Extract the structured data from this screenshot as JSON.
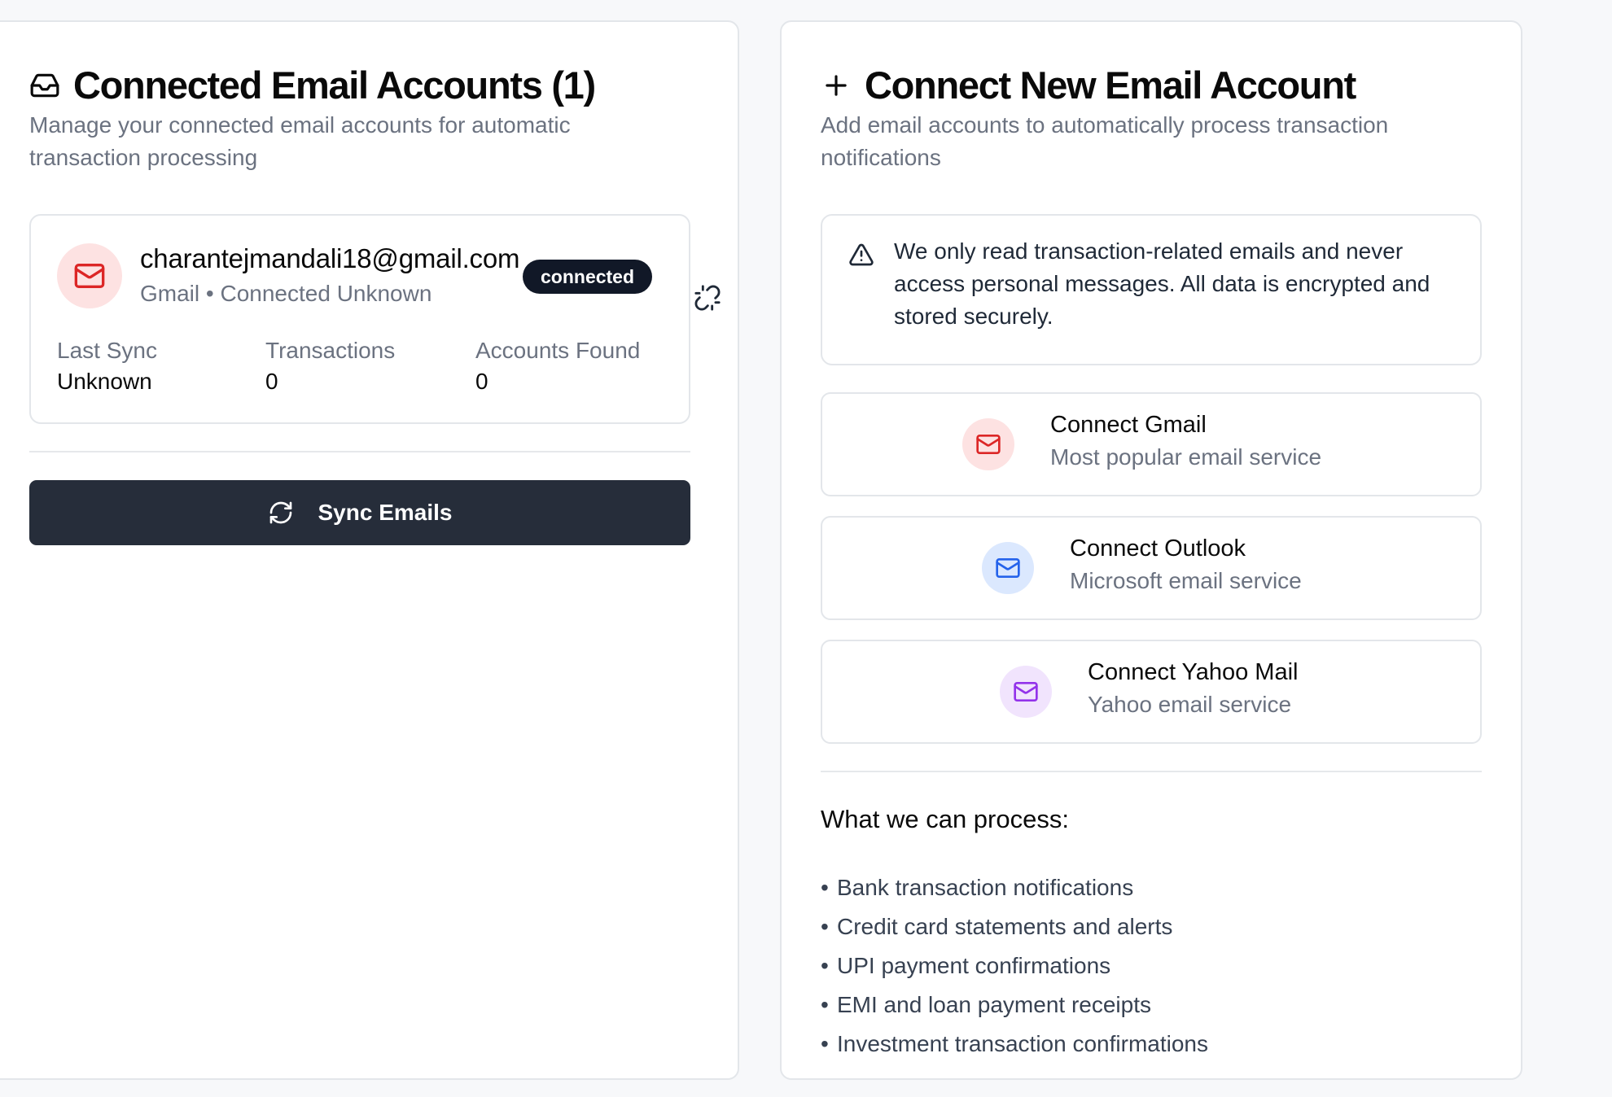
{
  "connected_panel": {
    "title": "Connected Email Accounts (1)",
    "icon": "inbox-icon",
    "description": "Manage your connected email accounts for automatic transaction processing",
    "account": {
      "email": "charantejmandali18@gmail.com",
      "meta": "Gmail • Connected Unknown",
      "status": "connected",
      "avatar_icon": "mail-icon",
      "stats": [
        {
          "label": "Last Sync",
          "value": "Unknown"
        },
        {
          "label": "Transactions",
          "value": "0"
        },
        {
          "label": "Accounts Found",
          "value": "0"
        }
      ]
    },
    "disconnect_icon": "unlink-icon",
    "sync_button": {
      "label": "Sync Emails",
      "icon": "refresh-icon"
    }
  },
  "new_panel": {
    "title": "Connect New Email Account",
    "icon": "plus-icon",
    "description": "Add email accounts to automatically process transaction notifications",
    "notice": {
      "icon": "warning-icon",
      "text": "We only read transaction-related emails and never access personal messages. All data is encrypted and stored securely."
    },
    "providers": [
      {
        "name": "Connect Gmail",
        "desc": "Most popular email service",
        "icon": "mail-icon",
        "color": "#dc2626",
        "bg": "#fde2e2"
      },
      {
        "name": "Connect Outlook",
        "desc": "Microsoft email service",
        "icon": "mail-icon",
        "color": "#2563eb",
        "bg": "#dbe8fe"
      },
      {
        "name": "Connect Yahoo Mail",
        "desc": "Yahoo email service",
        "icon": "mail-icon",
        "color": "#9333ea",
        "bg": "#f1e4fd"
      }
    ],
    "process_heading": "What we can process:",
    "process_items": [
      "Bank transaction notifications",
      "Credit card statements and alerts",
      "UPI payment confirmations",
      "EMI and loan payment receipts",
      "Investment transaction confirmations"
    ],
    "bullet": "•"
  },
  "colors": {
    "primary_dark": "#262d3a",
    "badge_dark": "#111827",
    "muted_text": "#6b7280",
    "border": "#e3e6ea"
  }
}
